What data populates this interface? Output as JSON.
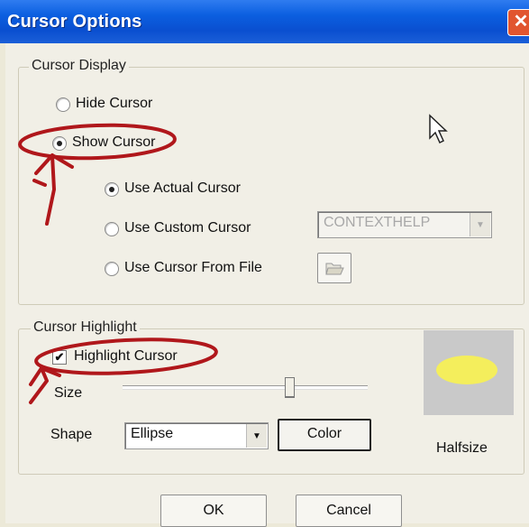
{
  "window": {
    "title": "Cursor Options",
    "close_glyph": "✕"
  },
  "cursor_display": {
    "group_label": "Cursor Display",
    "hide_cursor_label": "Hide Cursor",
    "show_cursor_label": "Show Cursor",
    "selected_display": "show",
    "use_actual_cursor_label": "Use Actual Cursor",
    "use_custom_cursor_label": "Use Custom Cursor",
    "use_cursor_from_file_label": "Use Cursor From File",
    "selected_cursor_source": "actual",
    "custom_cursor_value": "CONTEXTHELP"
  },
  "cursor_highlight": {
    "group_label": "Cursor Highlight",
    "highlight_cursor_label": "Highlight Cursor",
    "highlight_checked": true,
    "size_label": "Size",
    "size_level": 0.8,
    "shape_label": "Shape",
    "shape_value": "Ellipse",
    "color_button_label": "Color",
    "preview_caption": "Halfsize",
    "preview_color": "#f4ee5c"
  },
  "footer": {
    "ok_label": "OK",
    "cancel_label": "Cancel"
  },
  "annotations": {
    "marker_color": "#b0171b"
  }
}
